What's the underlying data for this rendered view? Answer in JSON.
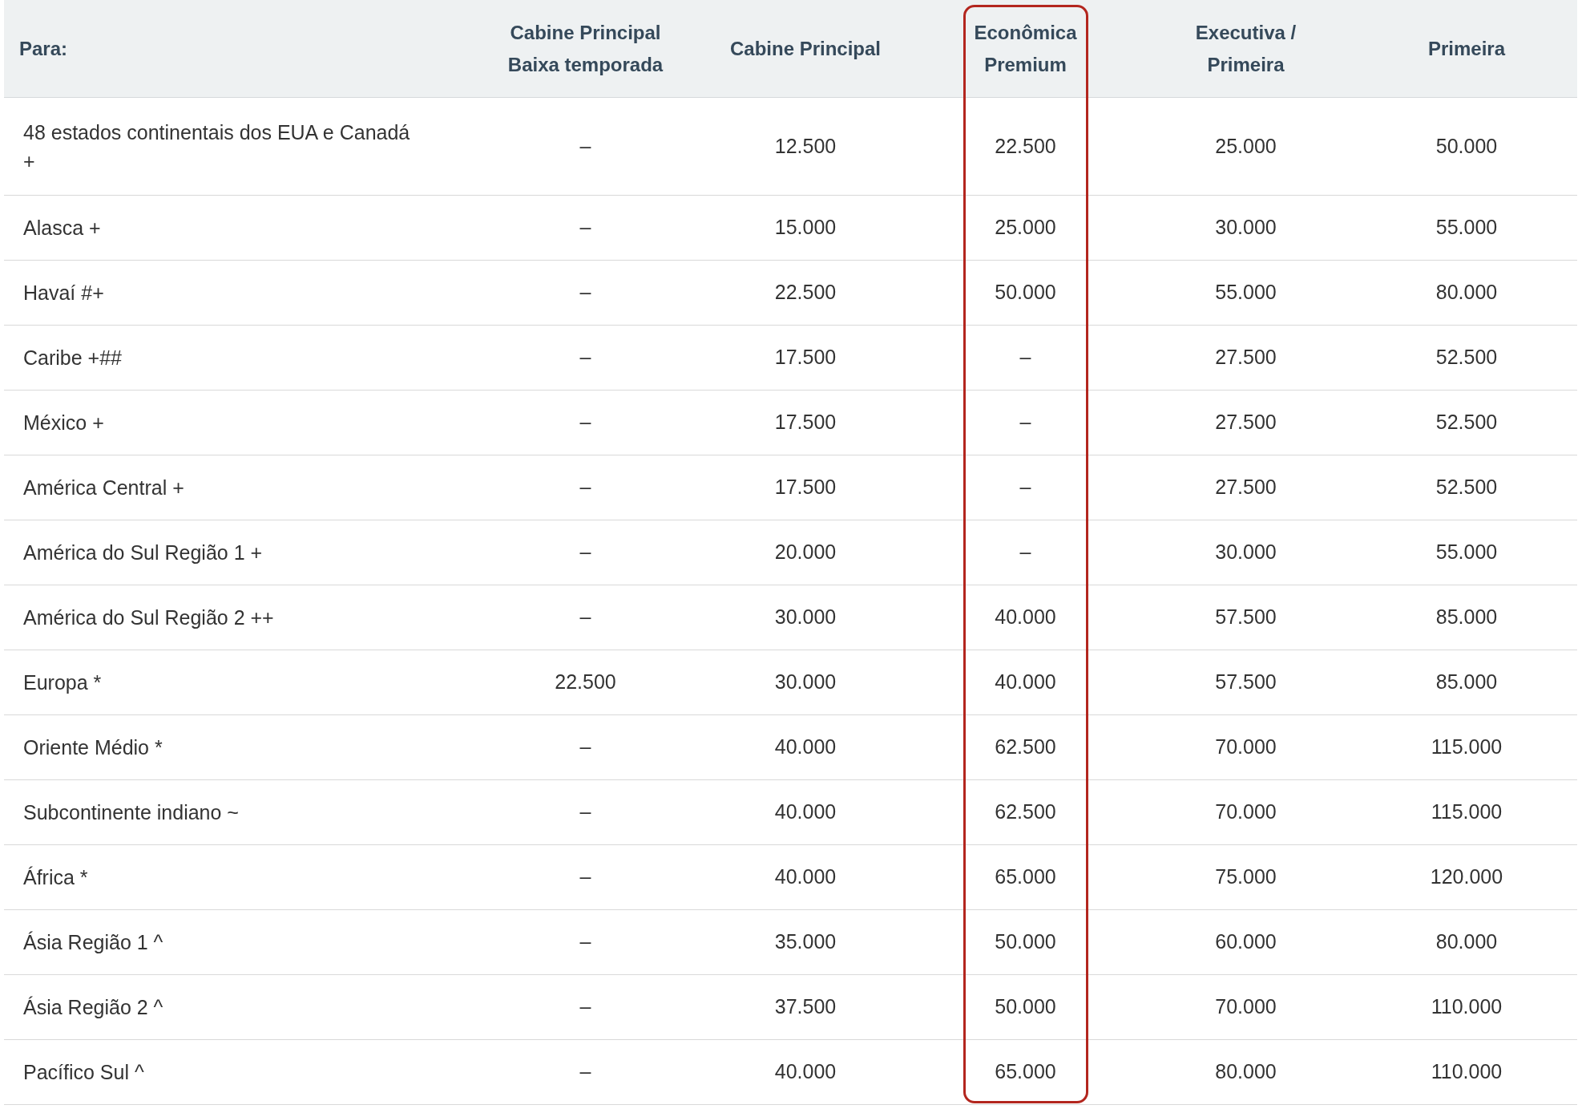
{
  "table": {
    "columns": [
      {
        "lines": [
          "Para:"
        ],
        "highlighted": false
      },
      {
        "lines": [
          "Cabine Principal",
          "Baixa temporada"
        ],
        "highlighted": false
      },
      {
        "lines": [
          "Cabine Principal"
        ],
        "highlighted": false
      },
      {
        "lines": [
          "Econômica",
          "Premium"
        ],
        "highlighted": true
      },
      {
        "lines": [
          "Executiva /",
          "Primeira"
        ],
        "highlighted": false
      },
      {
        "lines": [
          "Primeira"
        ],
        "highlighted": false
      }
    ],
    "rows": [
      {
        "destination": "48 estados continentais dos EUA e Canadá +",
        "values": [
          "–",
          "12.500",
          "22.500",
          "25.000",
          "50.000"
        ]
      },
      {
        "destination": "Alasca +",
        "values": [
          "–",
          "15.000",
          "25.000",
          "30.000",
          "55.000"
        ]
      },
      {
        "destination": "Havaí #+",
        "values": [
          "–",
          "22.500",
          "50.000",
          "55.000",
          "80.000"
        ]
      },
      {
        "destination": "Caribe +##",
        "values": [
          "–",
          "17.500",
          "–",
          "27.500",
          "52.500"
        ]
      },
      {
        "destination": "México +",
        "values": [
          "–",
          "17.500",
          "–",
          "27.500",
          "52.500"
        ]
      },
      {
        "destination": "América Central +",
        "values": [
          "–",
          "17.500",
          "–",
          "27.500",
          "52.500"
        ]
      },
      {
        "destination": "América do Sul Região 1 +",
        "values": [
          "–",
          "20.000",
          "–",
          "30.000",
          "55.000"
        ]
      },
      {
        "destination": "América do Sul Região 2 ++",
        "values": [
          "–",
          "30.000",
          "40.000",
          "57.500",
          "85.000"
        ]
      },
      {
        "destination": "Europa *",
        "values": [
          "22.500",
          "30.000",
          "40.000",
          "57.500",
          "85.000"
        ]
      },
      {
        "destination": "Oriente Médio *",
        "values": [
          "–",
          "40.000",
          "62.500",
          "70.000",
          "115.000"
        ]
      },
      {
        "destination": "Subcontinente indiano ~",
        "values": [
          "–",
          "40.000",
          "62.500",
          "70.000",
          "115.000"
        ]
      },
      {
        "destination": "África *",
        "values": [
          "–",
          "40.000",
          "65.000",
          "75.000",
          "120.000"
        ]
      },
      {
        "destination": "Ásia Região 1 ^",
        "values": [
          "–",
          "35.000",
          "50.000",
          "60.000",
          "80.000"
        ]
      },
      {
        "destination": "Ásia Região 2 ^",
        "values": [
          "–",
          "37.500",
          "50.000",
          "70.000",
          "110.000"
        ]
      },
      {
        "destination": "Pacífico Sul ^",
        "values": [
          "–",
          "40.000",
          "65.000",
          "80.000",
          "110.000"
        ]
      }
    ]
  }
}
